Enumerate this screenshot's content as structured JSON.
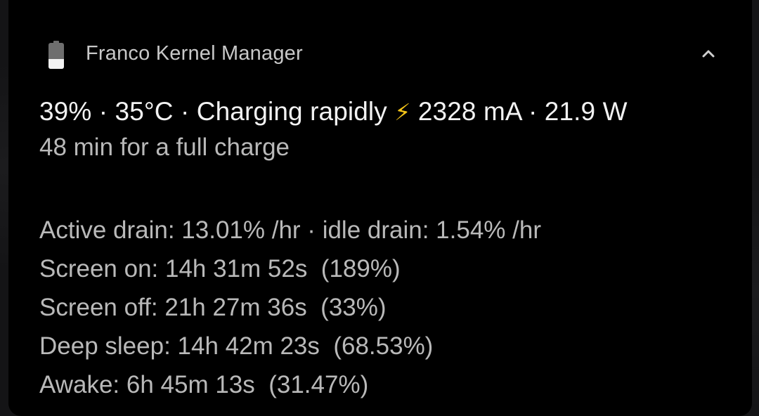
{
  "notification": {
    "app_name": "Franco Kernel Manager",
    "app_icon": "battery-icon",
    "expand_icon": "chevron-up-icon",
    "title": {
      "before_bolt": "39% · 35°C · Charging rapidly ",
      "bolt": "⚡",
      "after_bolt": " 2328 mA · 21.9 W"
    },
    "subtitle": "48 min for a full charge",
    "stats": [
      "Active drain: 13.01% /hr · idle drain: 1.54% /hr",
      "Screen on: 14h 31m 52s  (189%)",
      "Screen off: 21h 27m 36s  (33%)",
      "Deep sleep: 14h 42m 23s  (68.53%)",
      "Awake: 6h 45m 13s  (31.47%)"
    ]
  },
  "colors": {
    "background": "#000000",
    "primary_text": "#f2f2f2",
    "secondary_text": "#b9b9b9",
    "bolt": "#f5c518"
  }
}
